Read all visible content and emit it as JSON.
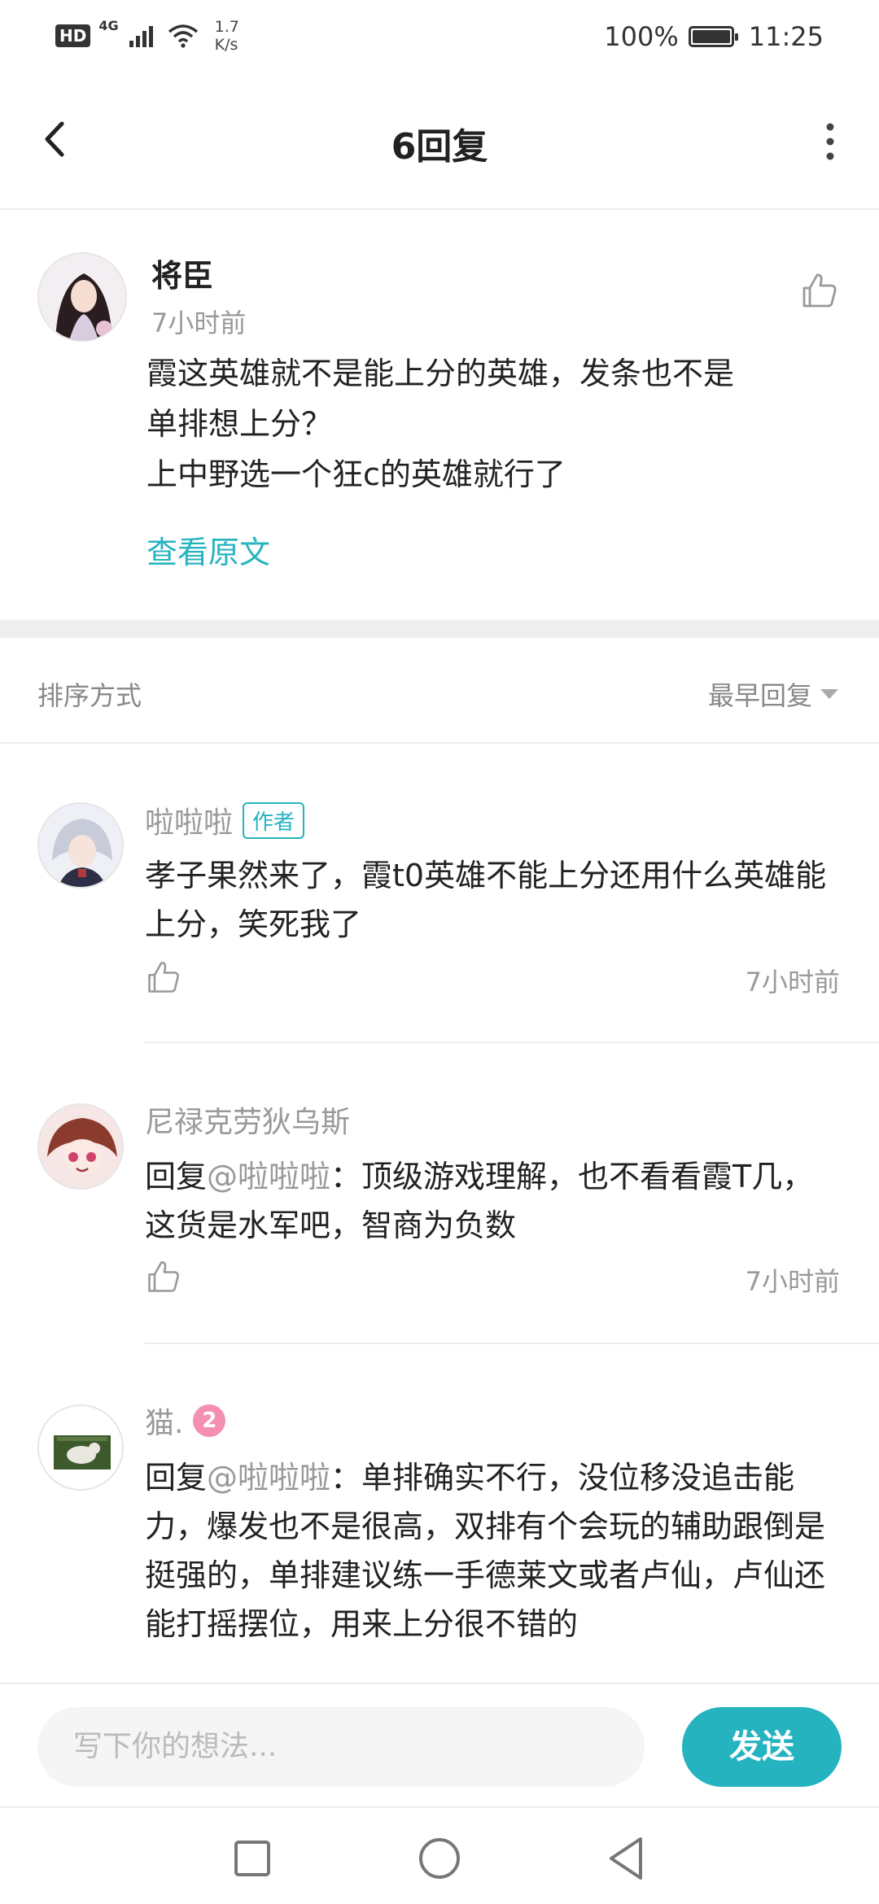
{
  "status_bar": {
    "hd": "HD",
    "network": "4G",
    "speed_value": "1.7",
    "speed_unit": "K/s",
    "battery": "100%",
    "time": "11:25"
  },
  "header": {
    "title": "6回复"
  },
  "post": {
    "author": "将臣",
    "time": "7小时前",
    "lines": [
      "霞这英雄就不是能上分的英雄，发条也不是",
      "单排想上分？",
      "上中野选一个狂c的英雄就行了"
    ],
    "view_original": "查看原文"
  },
  "sort": {
    "label": "排序方式",
    "value": "最早回复"
  },
  "replies": [
    {
      "name": "啦啦啦",
      "badge": "作者",
      "text": "孝子果然来了，霞t0英雄不能上分还用什么英雄能上分，笑死我了",
      "time": "7小时前"
    },
    {
      "name": "尼禄克劳狄乌斯",
      "reply_prefix": "回复",
      "mention": "@啦啦啦",
      "text": "：顶级游戏理解，也不看看霞T几，这货是水军吧，智商为负数",
      "time": "7小时前"
    },
    {
      "name": "猫.",
      "level": "2",
      "reply_prefix": "回复",
      "mention": "@啦啦啦",
      "text": "：单排确实不行，没位移没追击能力，爆发也不是很高，双排有个会玩的辅助跟倒是挺强的，单排建议练一手德莱文或者卢仙，卢仙还能打摇摆位，用来上分很不错的"
    }
  ],
  "input": {
    "placeholder": "写下你的想法...",
    "send": "发送"
  },
  "colors": {
    "accent": "#26b3c0",
    "muted_text": "#999999",
    "level_badge": "#f48fb1"
  }
}
